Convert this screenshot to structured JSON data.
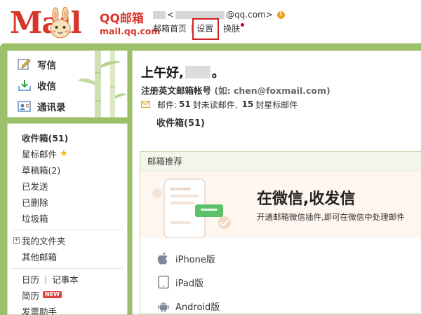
{
  "header": {
    "logo_word": "Mail",
    "brand_cn": "QQ邮箱",
    "brand_domain": "mail.qq.com",
    "account_prefix": "<",
    "account_suffix": "@qq.com>",
    "nav": {
      "home": "邮箱首页",
      "separator": "|",
      "settings": "设置",
      "skin": "换肤"
    }
  },
  "sidebar": {
    "quick": [
      {
        "label": "写信",
        "icon": "compose-icon"
      },
      {
        "label": "收信",
        "icon": "inbox-download-icon"
      },
      {
        "label": "通讯录",
        "icon": "contacts-icon"
      }
    ],
    "folders": {
      "inbox": "收件箱(51)",
      "starred": "星标邮件",
      "drafts": "草稿箱(2)",
      "sent": "已发送",
      "deleted": "已删除",
      "spam": "垃圾箱",
      "my_folders": "我的文件夹",
      "other_mail": "其他邮箱",
      "calendar": "日历",
      "calendar_sep": "|",
      "notes": "记事本",
      "resume": "简历",
      "new_badge": "NEW",
      "invoice": "发票助手"
    }
  },
  "main": {
    "greeting_prefix": "上午好,",
    "greeting_suffix": "。",
    "alias_title": "注册英文邮箱帐号",
    "alias_example": "(如: chen@foxmail.com)",
    "stats": {
      "label": "邮件:",
      "unread_count": "51",
      "unread_text": "封未读邮件,",
      "starred_count": "15",
      "starred_text": "封星标邮件"
    },
    "inbox_link": "收件箱(51)",
    "recommend": {
      "heading": "邮箱推荐",
      "banner_title": "在微信,收发信",
      "banner_subtitle": "开通邮箱微信插件,即可在微信中处理邮件",
      "downloads": [
        {
          "label": "iPhone版",
          "icon": "apple-icon"
        },
        {
          "label": "iPad版",
          "icon": "ipad-icon"
        },
        {
          "label": "Android版",
          "icon": "android-icon"
        }
      ]
    }
  },
  "colors": {
    "brand_red": "#d9362b",
    "band_green": "#9cbf69",
    "highlight_box": "#d42020"
  }
}
